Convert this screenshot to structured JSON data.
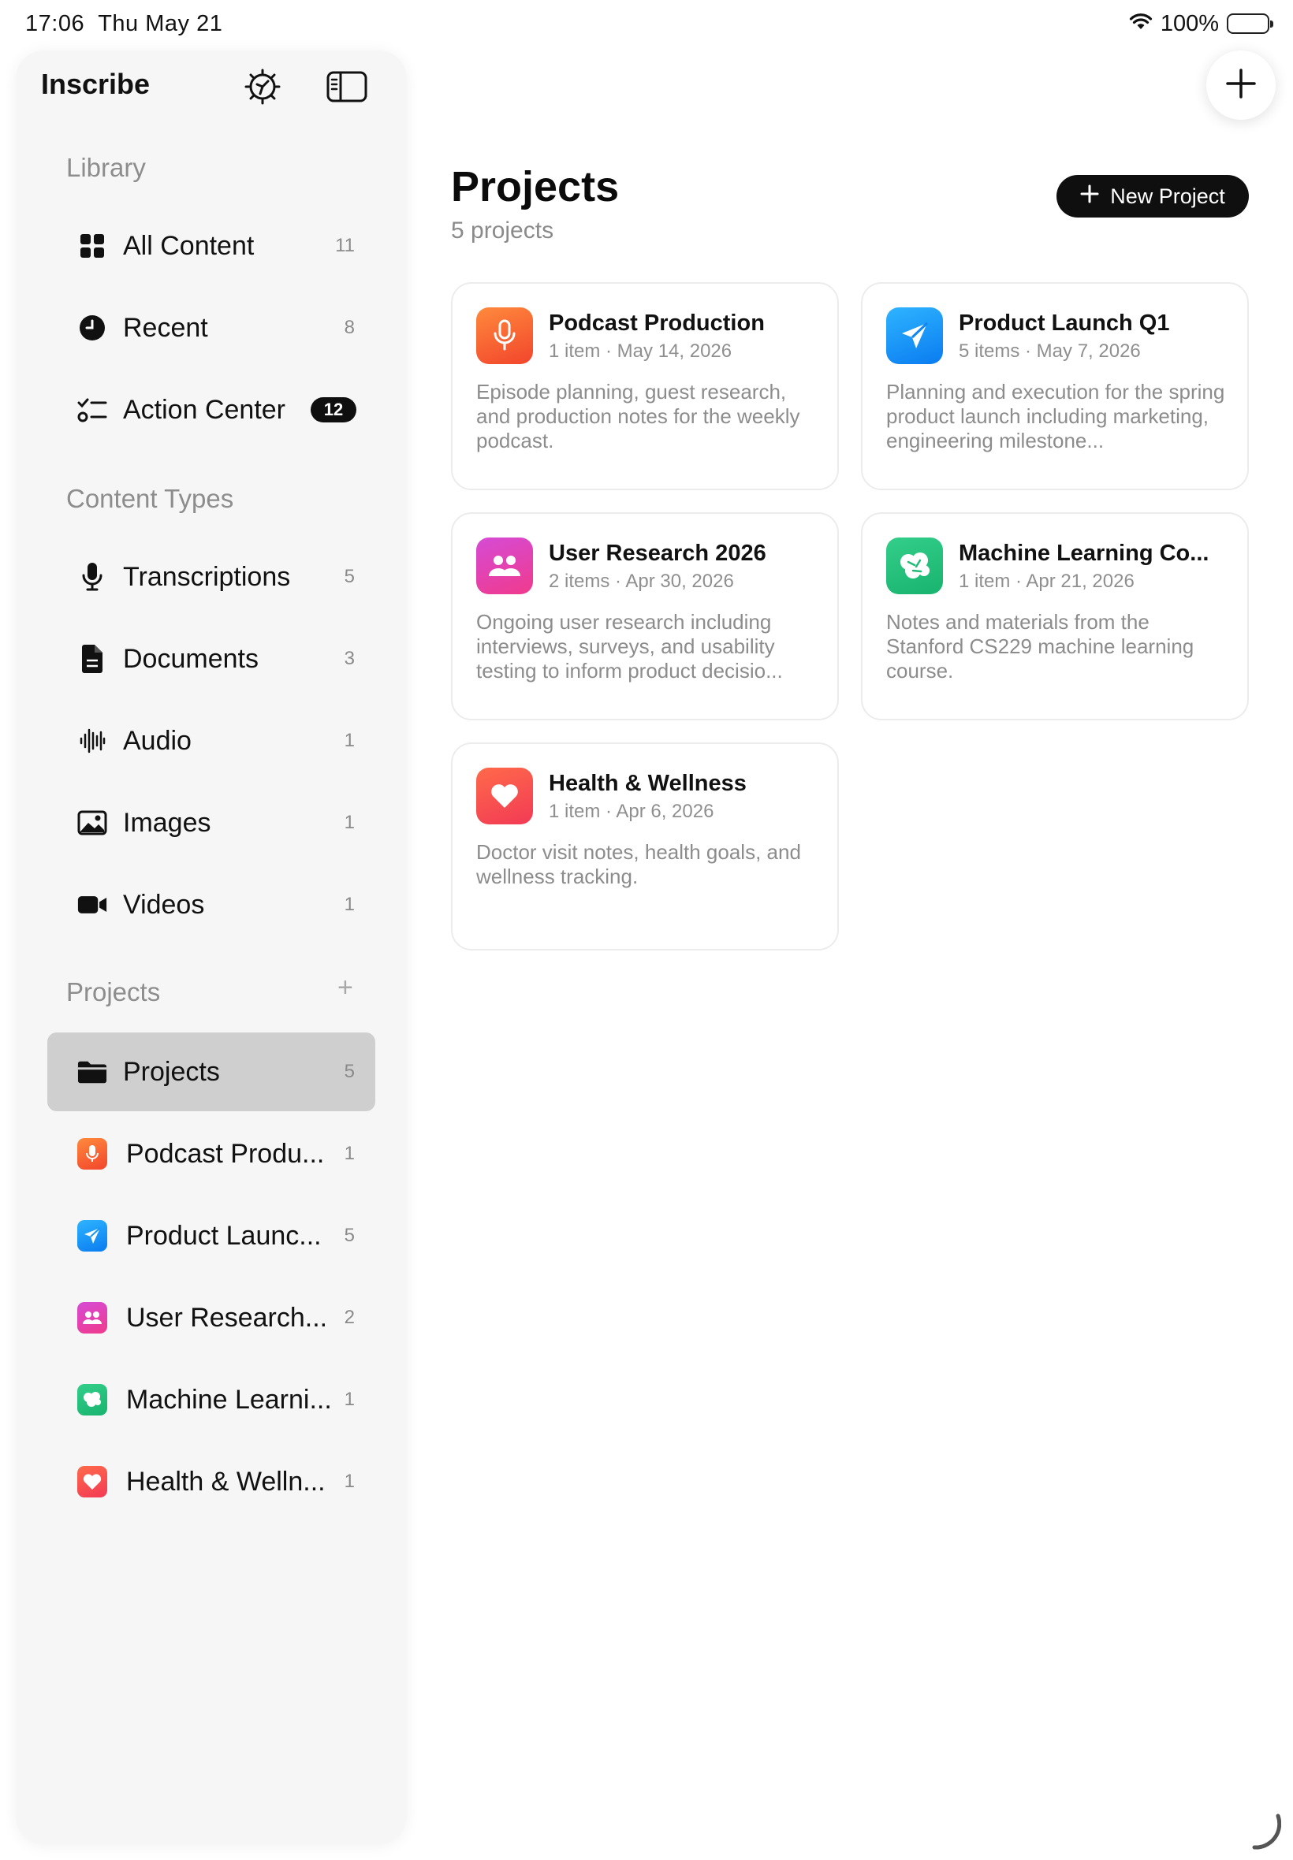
{
  "status_bar": {
    "time": "17:06",
    "date": "Thu May 21",
    "battery": "100%",
    "icons": [
      "wifi-icon",
      "battery-icon"
    ]
  },
  "sidebar": {
    "app_title": "Inscribe",
    "header_icons": [
      "settings-icon",
      "sidebar-toggle-icon"
    ],
    "library": {
      "title": "Library",
      "items": [
        {
          "label": "All Content",
          "count": "11",
          "icon": "grid-icon"
        },
        {
          "label": "Recent",
          "count": "8",
          "icon": "clock-icon"
        },
        {
          "label": "Action Center",
          "count": "12",
          "icon": "checklist-icon"
        }
      ]
    },
    "content_types": {
      "title": "Content Types",
      "items": [
        {
          "label": "Transcriptions",
          "count": "5",
          "icon": "microphone-icon"
        },
        {
          "label": "Documents",
          "count": "3",
          "icon": "document-icon"
        },
        {
          "label": "Audio",
          "count": "1",
          "icon": "waveform-icon"
        },
        {
          "label": "Images",
          "count": "1",
          "icon": "image-icon"
        },
        {
          "label": "Videos",
          "count": "1",
          "icon": "video-icon"
        }
      ]
    },
    "projects": {
      "title": "Projects",
      "add_label": "+",
      "all_item": {
        "label": "Projects",
        "count": "5",
        "icon": "folder-icon"
      },
      "items": [
        {
          "label": "Podcast Produ...",
          "count": "1",
          "icon": "microphone-icon",
          "color": "#f4612f"
        },
        {
          "label": "Product Launc...",
          "count": "5",
          "icon": "paper-plane-icon",
          "color": "#1496f7"
        },
        {
          "label": "User Research...",
          "count": "2",
          "icon": "people-icon",
          "color": "#e042b4"
        },
        {
          "label": "Machine Learni...",
          "count": "1",
          "icon": "brain-icon",
          "color": "#25c17c"
        },
        {
          "label": "Health & Welln...",
          "count": "1",
          "icon": "heart-icon",
          "color": "#f8484f"
        }
      ]
    }
  },
  "main": {
    "title": "Projects",
    "subtitle": "5 projects",
    "new_button": {
      "icon": "plus-icon",
      "label": "New Project"
    },
    "cards": [
      {
        "title": "Podcast Production",
        "meta": "1 item · May 14, 2026",
        "description": "Episode planning, guest research, and production notes for the weekly podcast.",
        "icon": "microphone-icon"
      },
      {
        "title": "Product Launch Q1",
        "meta": "5 items · May 7, 2026",
        "description": "Planning and execution for the spring product launch including marketing, engineering milestone...",
        "icon": "paper-plane-icon"
      },
      {
        "title": "User Research 2026",
        "meta": "2 items · Apr 30, 2026",
        "description": "Ongoing user research including interviews, surveys, and usability testing to inform product decisio...",
        "icon": "people-icon"
      },
      {
        "title": "Machine Learning Co...",
        "meta": "1 item · Apr 21, 2026",
        "description": "Notes and materials from the Stanford CS229 machine learning course.",
        "icon": "brain-icon"
      },
      {
        "title": "Health & Wellness",
        "meta": "1 item · Apr 6, 2026",
        "description": "Doctor visit notes, health goals, and wellness tracking.",
        "icon": "heart-icon"
      }
    ]
  },
  "add_button_icon": "plus-icon"
}
